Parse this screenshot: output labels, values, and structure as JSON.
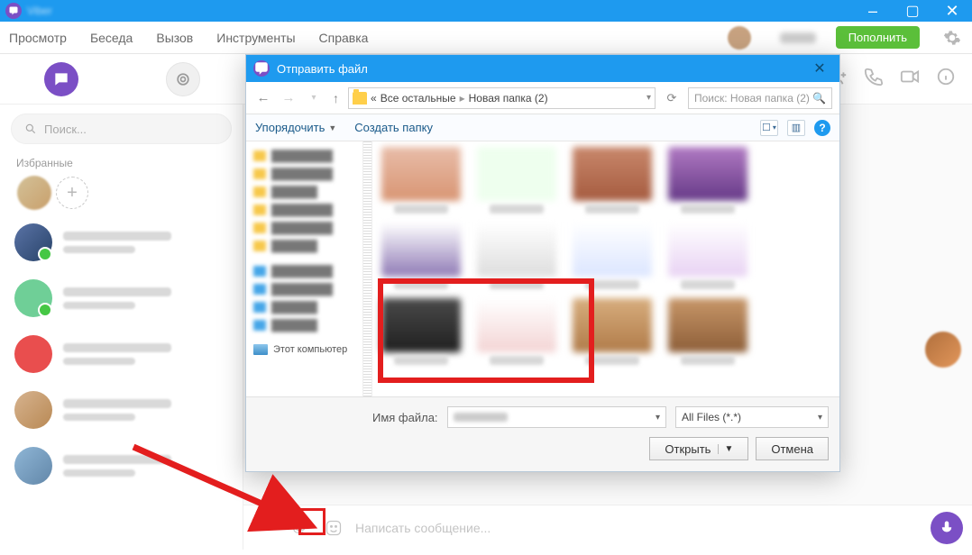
{
  "title_bar": {
    "app_name": "Viber"
  },
  "window_controls": {
    "min": "–",
    "max": "▢",
    "close": "✕"
  },
  "menu": {
    "view": "Просмотр",
    "chat": "Беседа",
    "call": "Вызов",
    "tools": "Инструменты",
    "help": "Справка"
  },
  "header": {
    "topup": "Пополнить"
  },
  "nav": {
    "more": "ooo"
  },
  "sidebar": {
    "search_placeholder": "Поиск...",
    "favorites": "Избранные",
    "add": "+"
  },
  "composer": {
    "plus": "+",
    "at": "@",
    "placeholder": "Написать сообщение..."
  },
  "dialog": {
    "title": "Отправить файл",
    "close": "✕",
    "up": "↑",
    "refresh": "⟳",
    "crumb_pre": "«",
    "crumb1": "Все остальные",
    "crumb2": "Новая папка (2)",
    "sep": "▸",
    "search_placeholder": "Поиск: Новая папка (2)",
    "organize": "Упорядочить",
    "newfolder": "Создать папку",
    "tree_pc": "Этот компьютер",
    "filename_label": "Имя файла:",
    "filetype": "All Files (*.*)",
    "open": "Открыть",
    "cancel": "Отмена",
    "help": "?"
  }
}
